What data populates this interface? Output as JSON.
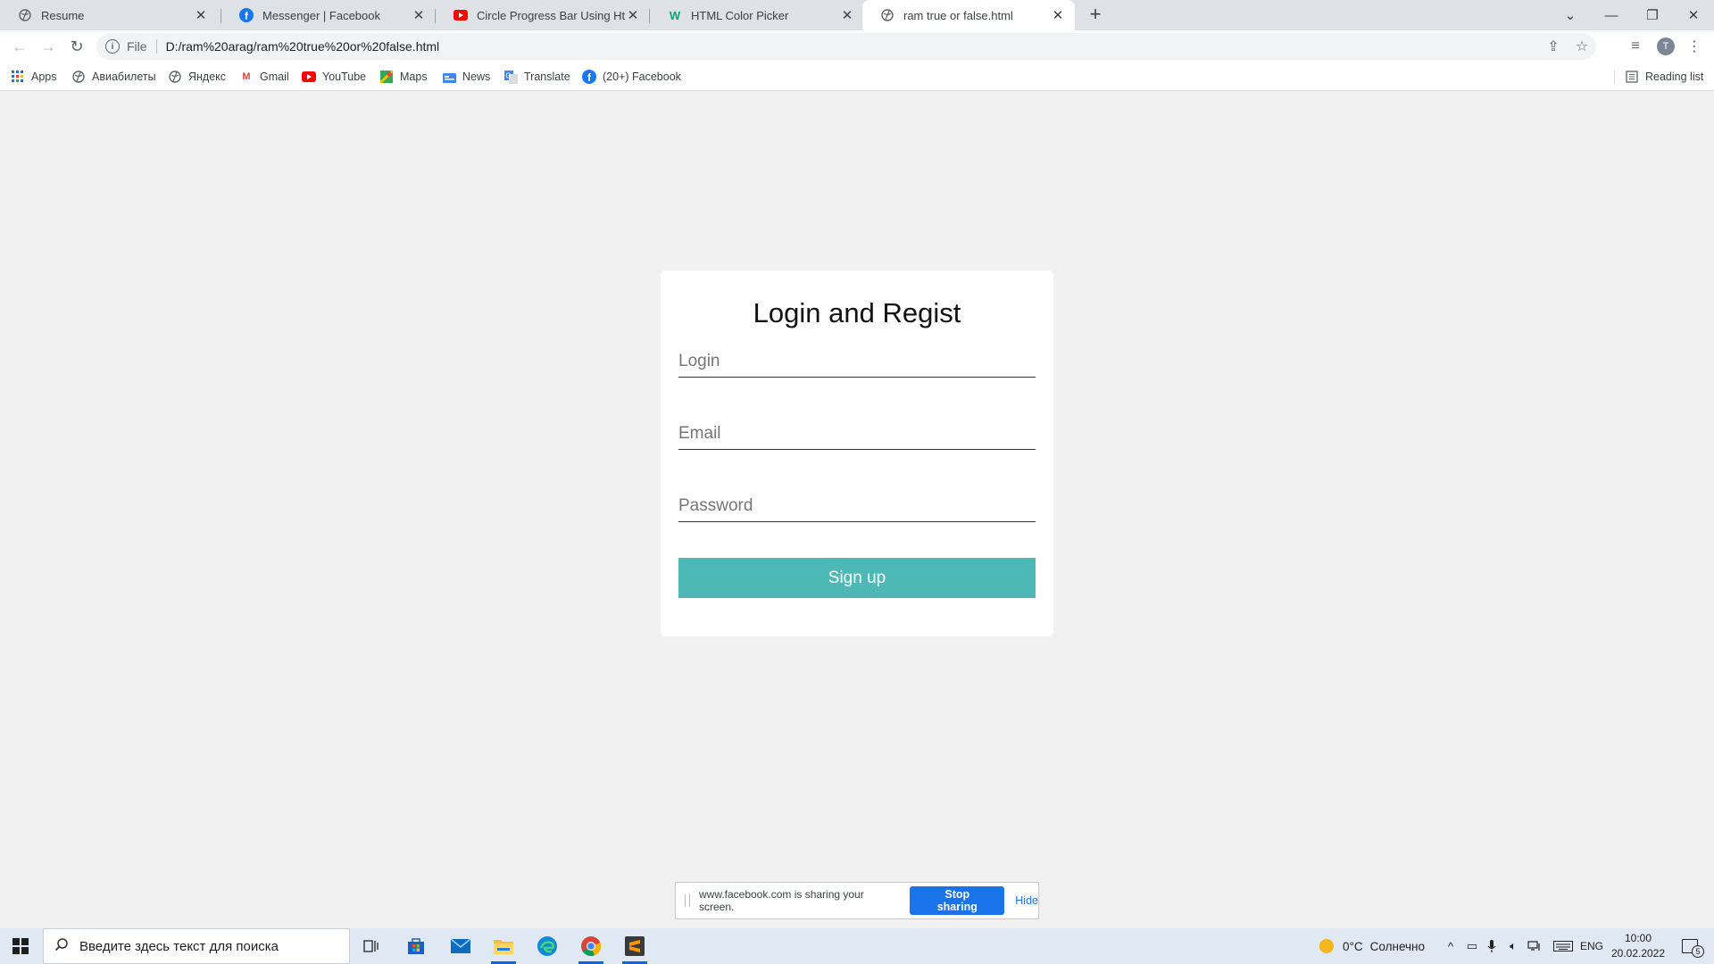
{
  "browser": {
    "tabs": [
      {
        "title": "Resume",
        "favicon": "globe-icon"
      },
      {
        "title": "Messenger | Facebook",
        "favicon": "facebook-icon"
      },
      {
        "title": "Circle Progress Bar Using Html C",
        "favicon": "youtube-icon"
      },
      {
        "title": "HTML Color Picker",
        "favicon": "w3schools-icon"
      },
      {
        "title": "ram true or false.html",
        "favicon": "globe-icon",
        "active": true
      }
    ],
    "address": {
      "scheme_label": "File",
      "url": "D:/ram%20arag/ram%20true%20or%20false.html"
    },
    "bookmarks": [
      {
        "label": "Apps",
        "icon": "apps-grid-icon"
      },
      {
        "label": "Авиабилеты",
        "icon": "globe-icon"
      },
      {
        "label": "Яндекс",
        "icon": "globe-icon"
      },
      {
        "label": "Gmail",
        "icon": "gmail-icon"
      },
      {
        "label": "YouTube",
        "icon": "youtube-icon"
      },
      {
        "label": "Maps",
        "icon": "maps-icon"
      },
      {
        "label": "News",
        "icon": "news-icon"
      },
      {
        "label": "Translate",
        "icon": "translate-icon"
      },
      {
        "label": "(20+) Facebook",
        "icon": "facebook-icon"
      }
    ],
    "reading_list_label": "Reading list",
    "avatar_initial": "T"
  },
  "form": {
    "title": "Login and Regist",
    "login_placeholder": "Login",
    "email_placeholder": "Email",
    "password_placeholder": "Password",
    "submit_label": "Sign up",
    "accent_color": "#4db8b6"
  },
  "sharing": {
    "message": "www.facebook.com is sharing your screen.",
    "stop_label": "Stop sharing",
    "hide_label": "Hide"
  },
  "taskbar": {
    "search_placeholder": "Введите здесь текст для поиска",
    "weather_temp": "0°C",
    "weather_text": "Солнечно",
    "language": "ENG",
    "time": "10:00",
    "date": "20.02.2022",
    "notification_count": "5"
  }
}
